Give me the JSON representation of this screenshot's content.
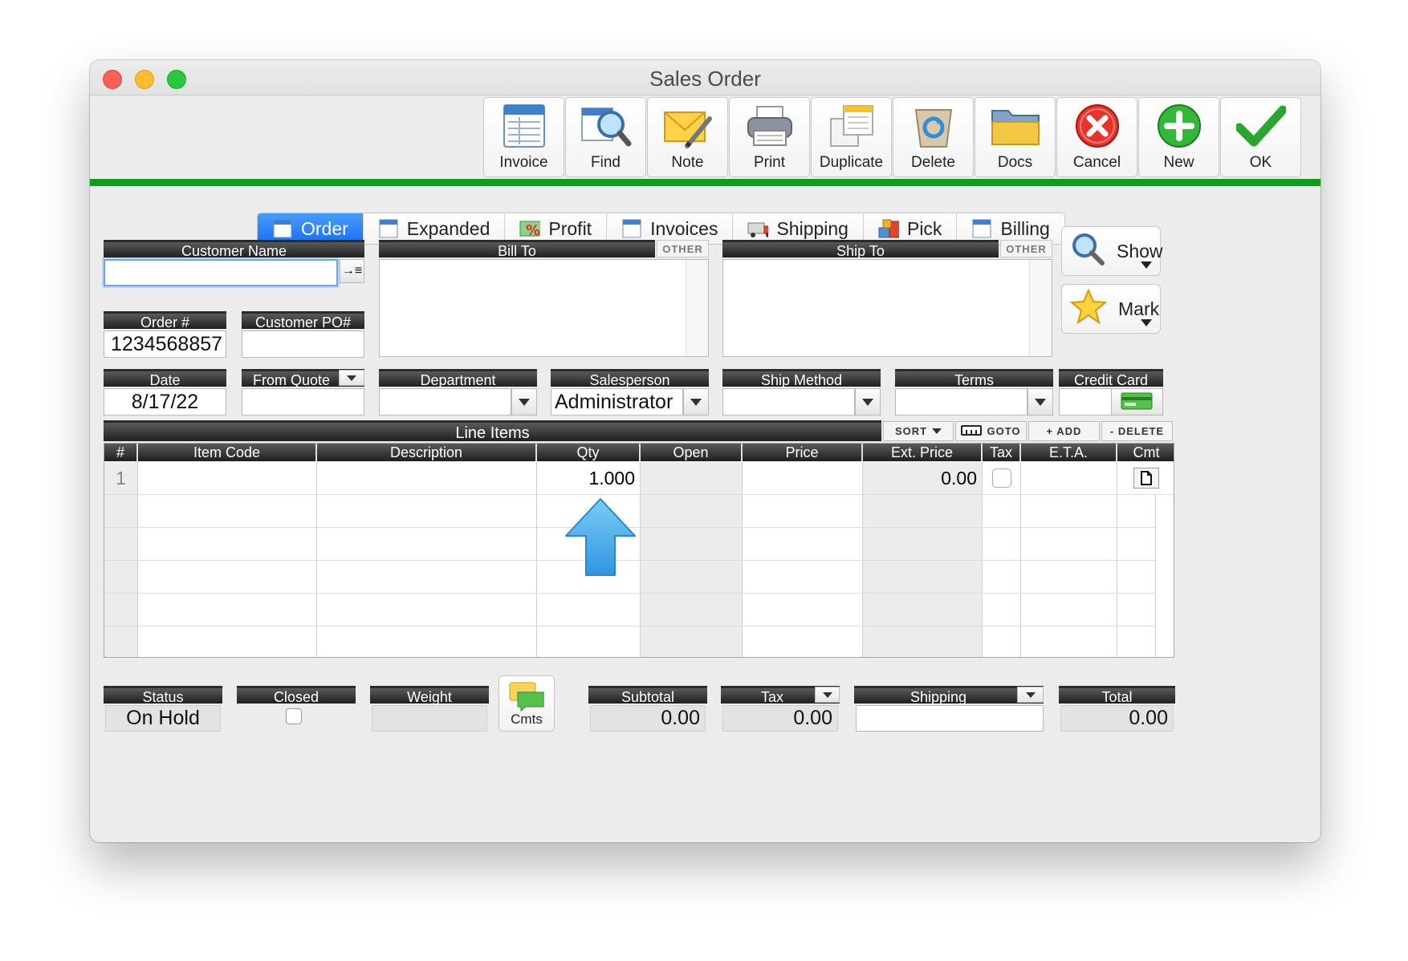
{
  "window": {
    "title": "Sales Order"
  },
  "toolbar": [
    {
      "label": "Invoice",
      "icon": "invoice-icon"
    },
    {
      "label": "Find",
      "icon": "find-icon"
    },
    {
      "label": "Note",
      "icon": "note-icon"
    },
    {
      "label": "Print",
      "icon": "print-icon"
    },
    {
      "label": "Duplicate",
      "icon": "duplicate-icon"
    },
    {
      "label": "Delete",
      "icon": "delete-icon"
    },
    {
      "label": "Docs",
      "icon": "docs-icon"
    },
    {
      "label": "Cancel",
      "icon": "cancel-icon"
    },
    {
      "label": "New",
      "icon": "new-icon"
    },
    {
      "label": "OK",
      "icon": "ok-icon"
    }
  ],
  "tabs": [
    {
      "label": "Order",
      "active": true
    },
    {
      "label": "Expanded"
    },
    {
      "label": "Profit"
    },
    {
      "label": "Invoices"
    },
    {
      "label": "Shipping"
    },
    {
      "label": "Pick"
    },
    {
      "label": "Billing"
    }
  ],
  "fields": {
    "customer_name": {
      "label": "Customer Name",
      "value": ""
    },
    "bill_to": {
      "label": "Bill To",
      "other": "OTHER"
    },
    "ship_to": {
      "label": "Ship To",
      "other": "OTHER"
    },
    "order_no": {
      "label": "Order #",
      "value": "1234568857"
    },
    "customer_po": {
      "label": "Customer PO#",
      "value": ""
    },
    "date": {
      "label": "Date",
      "value": "8/17/22"
    },
    "from_quote": {
      "label": "From Quote",
      "value": ""
    },
    "department": {
      "label": "Department",
      "value": ""
    },
    "salesperson": {
      "label": "Salesperson",
      "value": "Administrator"
    },
    "ship_method": {
      "label": "Ship Method",
      "value": ""
    },
    "terms": {
      "label": "Terms",
      "value": ""
    },
    "credit_card": {
      "label": "Credit Card",
      "value": ""
    }
  },
  "side_buttons": {
    "show": "Show",
    "mark": "Mark"
  },
  "line_items": {
    "title": "Line Items",
    "buttons": {
      "sort": "SORT",
      "goto": "GOTO",
      "add": "+ ADD",
      "delete": "- DELETE"
    },
    "columns": [
      "#",
      "Item Code",
      "Description",
      "Qty",
      "Open",
      "Price",
      "Ext. Price",
      "Tax",
      "E.T.A.",
      "Cmt"
    ],
    "rows": [
      {
        "num": "1",
        "item_code": "",
        "description": "",
        "qty": "1.000",
        "open": "",
        "price": "",
        "ext_price": "0.00",
        "tax": false,
        "eta": ""
      }
    ]
  },
  "footer": {
    "status": {
      "label": "Status",
      "value": "On Hold"
    },
    "closed": {
      "label": "Closed",
      "checked": false
    },
    "weight": {
      "label": "Weight",
      "value": ""
    },
    "cmts": "Cmts",
    "subtotal": {
      "label": "Subtotal",
      "value": "0.00"
    },
    "tax": {
      "label": "Tax",
      "value": "0.00"
    },
    "shipping": {
      "label": "Shipping",
      "value": ""
    },
    "total": {
      "label": "Total",
      "value": "0.00"
    }
  }
}
